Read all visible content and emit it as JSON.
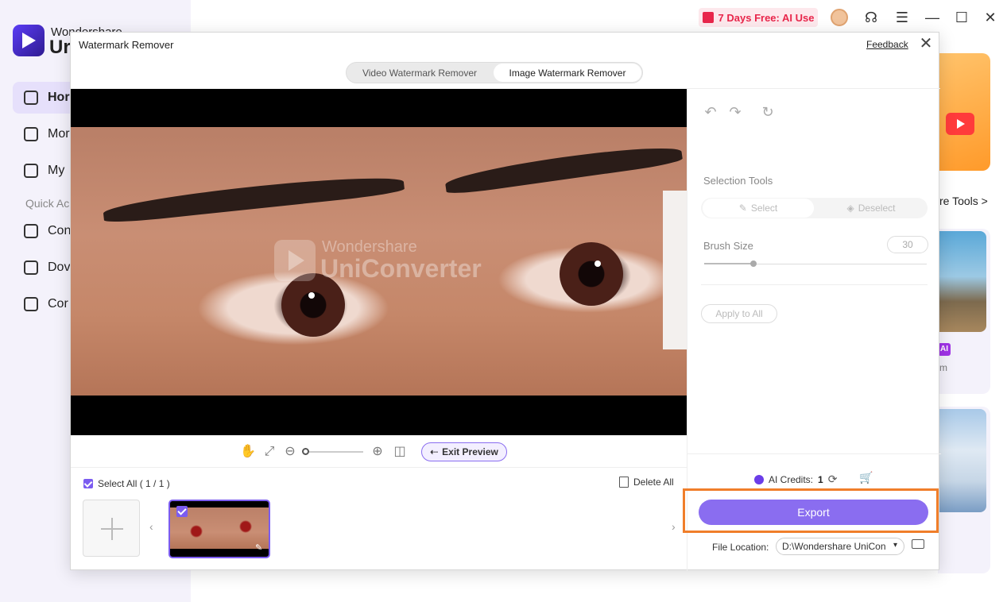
{
  "app": {
    "brand_top": "Wondershare",
    "brand_bottom": "Ur",
    "nav": [
      {
        "label": "Hor"
      },
      {
        "label": "Mor"
      },
      {
        "label": "My"
      },
      {
        "label": "Con"
      },
      {
        "label": "Dov"
      },
      {
        "label": "Cor"
      }
    ],
    "quick_access": "Quick Ac",
    "free_badge": "7 Days Free: AI Use",
    "more_tools": "re Tools  >",
    "ai_chip": "AI",
    "card_text": "m",
    "accent_color": "#8a6df0",
    "highlight_color": "#f07e2a"
  },
  "modal": {
    "title": "Watermark Remover",
    "feedback": "Feedback",
    "close_icon": "✕",
    "tabs": [
      {
        "label": "Video Watermark Remover",
        "active": false
      },
      {
        "label": "Image Watermark Remover",
        "active": true
      }
    ],
    "watermark": {
      "line1": "Wondershare",
      "line2": "UniConverter"
    },
    "toolbar": {
      "exit_preview": "Exit Preview",
      "zoom_level": 0
    },
    "thumbs": {
      "select_all": "Select All ( 1 / 1 )",
      "delete_all": "Delete All",
      "prev_arrow": "‹",
      "next_arrow": "›"
    },
    "panel": {
      "selection_tools": "Selection Tools",
      "select": "Select",
      "deselect": "Deselect",
      "brush_size_label": "Brush Size",
      "brush_size_value": "30",
      "brush_size_fraction": 0.22,
      "apply_all": "Apply to All",
      "credits_label": "AI Credits:",
      "credits_value": "1",
      "export": "Export",
      "file_location_label": "File Location:",
      "file_location_value": "D:\\Wondershare UniCon"
    }
  }
}
